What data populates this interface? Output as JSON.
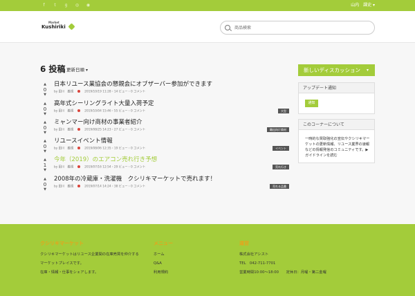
{
  "topbar": {
    "user": "山内　課史 ▾",
    "social_icons": [
      "facebook-icon",
      "twitter-icon",
      "google-plus-icon",
      "instagram-icon",
      "rss-icon"
    ]
  },
  "header": {
    "logo_sub": "Market",
    "logo_main": "Kushiriki",
    "search_placeholder": "商品検索"
  },
  "main": {
    "count_title": "6 投稿",
    "sort_label": "更新日順",
    "sort_caret": "▾"
  },
  "posts": [
    {
      "votes": "0",
      "title": "日本リユース業協会の懇親会にオブザーバー参加ができます",
      "meta_author": "by 田川　義規",
      "meta_date": "2019/10/19 11:28・14 ビュー・0 コメント",
      "tag": "",
      "highlight": false
    },
    {
      "votes": "0",
      "title": "高年式シーリングライト大量入荷予定",
      "meta_author": "by 田川　義規",
      "meta_date": "2019/10/04 15:46・55 ビュー・0 コメント",
      "tag": "大型",
      "highlight": false
    },
    {
      "votes": "0",
      "title": "ミャンマー向け商材の事業者紹介",
      "meta_author": "by 田川　義規",
      "meta_date": "2019/08/25 14:23・27 ビュー・0 コメント",
      "tag": "輸出向け商材",
      "highlight": false
    },
    {
      "votes": "0",
      "title": "リユースイベント情報",
      "meta_author": "by 田川　義規",
      "meta_date": "2019/08/06 12:35・19 ビュー・0 コメント",
      "tag": "イベント",
      "highlight": false
    },
    {
      "votes": "1",
      "title": "今年（2019）のエアコン売れ行き予想",
      "meta_author": "by 田川　義規",
      "meta_date": "2019/07/16 12:54・29 ビュー・0 コメント",
      "tag": "売れ行き",
      "highlight": true
    },
    {
      "votes": "0",
      "title": "2008年の冷蔵庫・洗濯機　クシリキマーケットで売れます！",
      "meta_author": "by 田川　義規",
      "meta_date": "2019/07/14 14:24・38 ビュー・0 コメント",
      "tag": "売れる品番",
      "highlight": false
    }
  ],
  "sidebar": {
    "new_discussion": "新しいディスカッション",
    "new_caret": "▾",
    "update_panel_title": "アップデート通知",
    "update_button": "通知",
    "about_panel_title": "このコーナーについて",
    "about_text": "一時的な買取強化の宣伝やクシリキマーケットの更新情報、リユース業界の速報などの情報発信のコミュニティです。",
    "about_link": "▶ ガイドラインを読む"
  },
  "footer": {
    "col1_title": "クシリキマーケット",
    "col1_text1": "クシリキマーケットはリユース企業間の在庫売買を仲介する",
    "col1_text2": "マーケットプレイスです。",
    "col1_text3": "在庫・情報・仕事をシェアします。",
    "col2_title": "メニュー",
    "col2_items": [
      "ホーム",
      "Q&A",
      "利用規約"
    ],
    "col3_title": "運営",
    "col3_company": "株式会社アシスト",
    "col3_tel": "TEL　042-711-7701",
    "col3_hours": "営業時間10:00〜18:00　　定休日：月曜・第二金曜"
  }
}
